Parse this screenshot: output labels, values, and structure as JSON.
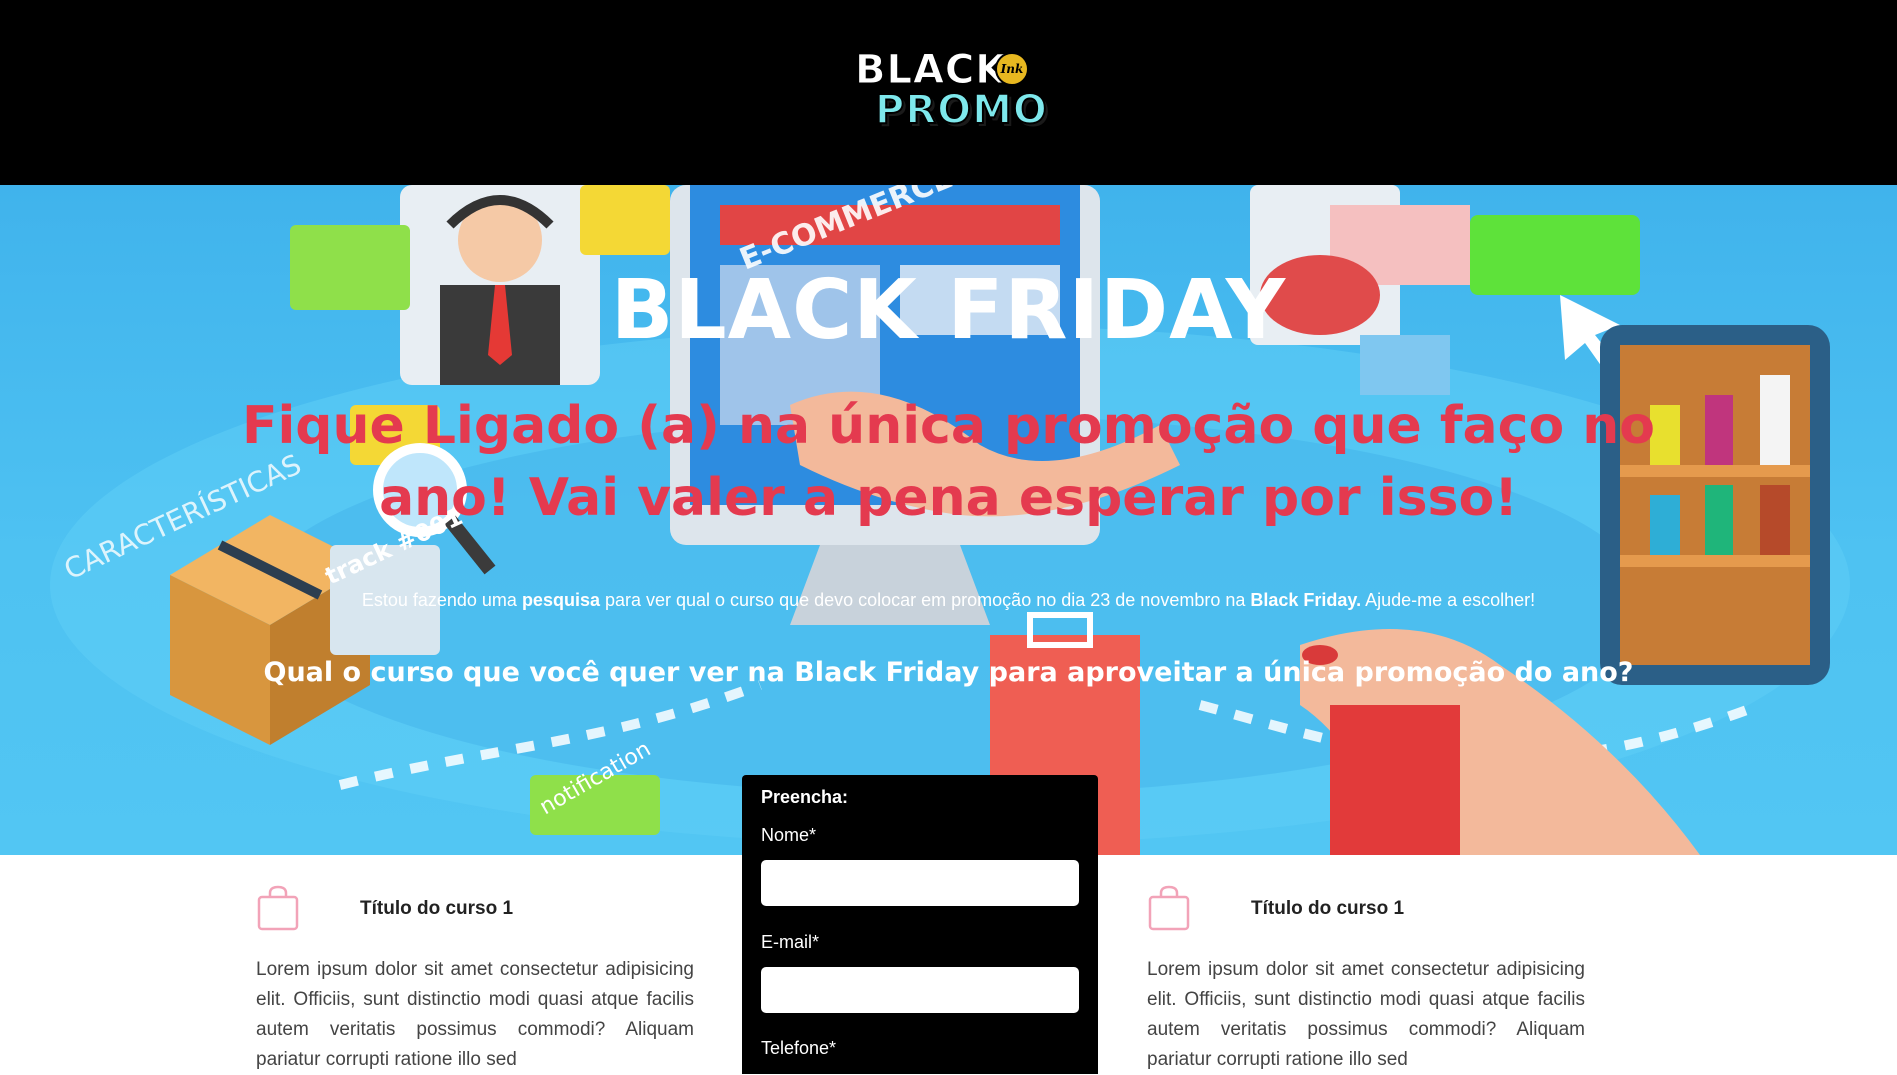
{
  "header": {
    "logo_line1": "BLACK",
    "logo_line2": "PROMO",
    "logo_badge": "Ink"
  },
  "hero": {
    "title": "BLACK FRIDAY",
    "subtitle": "Fique Ligado (a) na única promoção que faço no ano! Vai valer a pena esperar por isso!",
    "text_parts": [
      "Estou fazendo uma ",
      "pesquisa",
      " para ver qual o curso que devo colocar em promoção no dia 23 de novembro na ",
      "Black Friday.",
      " Ajude-me a escolher!"
    ],
    "question": "Qual o curso que você quer ver na Black Friday para aproveitar a única promoção do ano?",
    "art_labels": {
      "ecommerce": "E-COMMERCE",
      "caracteristicas": "CARACTERÍSTICAS",
      "track": "track #001",
      "notification": "notification"
    }
  },
  "form": {
    "heading": "Preencha:",
    "fields": [
      {
        "label": "Nome*",
        "value": ""
      },
      {
        "label": "E-mail*",
        "value": ""
      },
      {
        "label": "Telefone*",
        "value": ""
      }
    ]
  },
  "courses": [
    {
      "icon": "shopping-bag-icon",
      "title": "Título do curso 1",
      "description": "Lorem ipsum dolor sit amet consectetur adipisicing elit. Officiis, sunt distinctio modi quasi atque facilis autem veritatis possimus commodi? Aliquam pariatur corrupti ratione illo sed"
    },
    {
      "icon": "shopping-bag-icon",
      "title": "Título do curso 1",
      "description": "Lorem ipsum dolor sit amet consectetur adipisicing elit. Officiis, sunt distinctio modi quasi atque facilis autem veritatis possimus commodi? Aliquam pariatur corrupti ratione illo sed"
    }
  ],
  "colors": {
    "header_bg": "#000000",
    "hero_bg": "#4ec2f2",
    "subtitle": "#e43a4f",
    "icon_pink": "#f2a3b8"
  }
}
